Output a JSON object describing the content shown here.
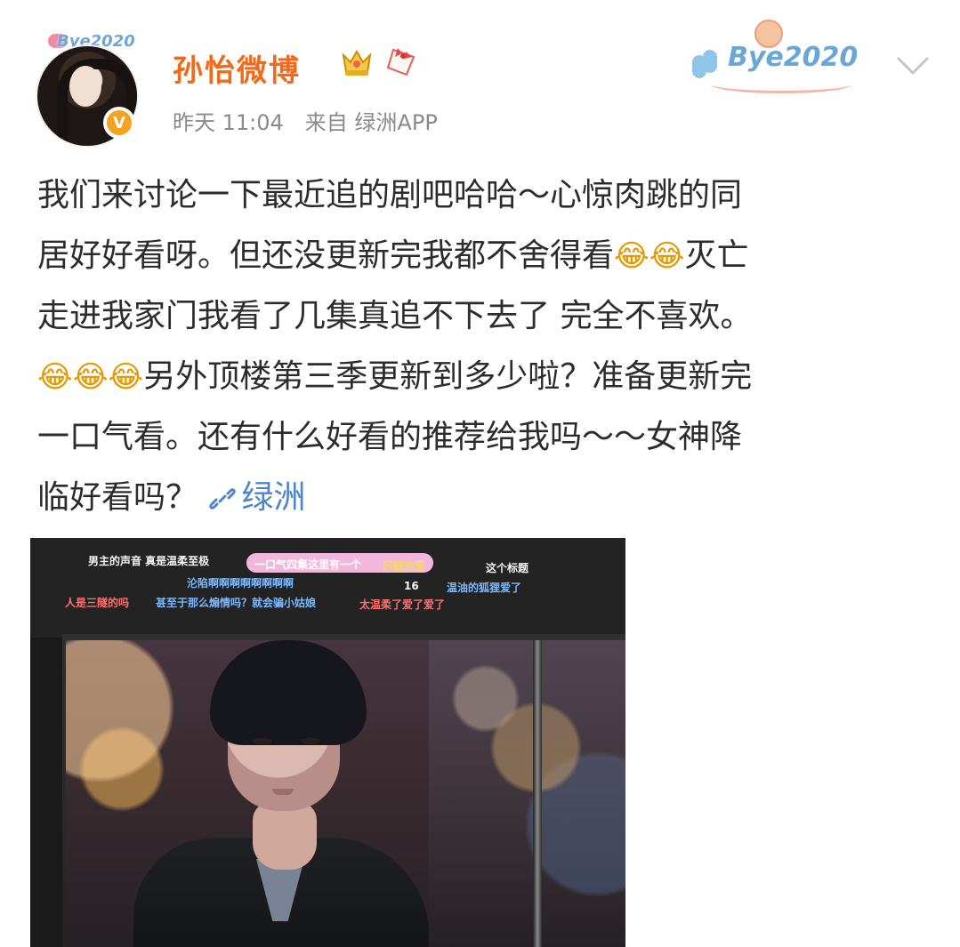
{
  "header": {
    "username": "孙怡微博",
    "meta_time": "昨天 11:04",
    "meta_source": "来自 绿洲APP"
  },
  "decor": {
    "avatar_badge_text": "Bye2020",
    "top_badge_text": "Bye2020"
  },
  "post": {
    "line1": "我们来讨论一下最近追的剧吧哈哈～心惊肉跳的同",
    "line2_before_emoji": "居好好看呀。但还没更新完我都不舍得看",
    "line2_after_emoji": "灭亡",
    "line3": "走进我家门我看了几集真追不下去了 完全不喜欢。",
    "line4_after_emoji": "另外顶楼第三季更新到多少啦？准备更新完",
    "line5": "一口气看。还有什么好看的推荐给我吗～～女神降",
    "line6_before_link": "临好看吗？",
    "link_label": "绿洲"
  },
  "media": {
    "danmaku": [
      "男主的声音 真是温柔至极",
      "一口气四集这里有一个",
      "好糖恋爱",
      "这个标题",
      "沦陷啊啊啊啊啊啊啊啊",
      "16",
      "温油的狐狸爱了",
      "人是三隧的吗",
      "甚至于那么煽情吗？就会骗小姑娘",
      "太温柔了爱了爱了"
    ]
  },
  "icons": {
    "crown": "crown-icon",
    "scroll": "scroll-icon",
    "dropdown": "chevron-down-icon",
    "link": "link-icon",
    "verified": "verified-icon",
    "emoji": "laughing-crying-face-icon"
  },
  "colors": {
    "username": "#f06a1a",
    "meta": "#8a8a8a",
    "link": "#4d84cc",
    "badge": "#6aa6d6"
  }
}
